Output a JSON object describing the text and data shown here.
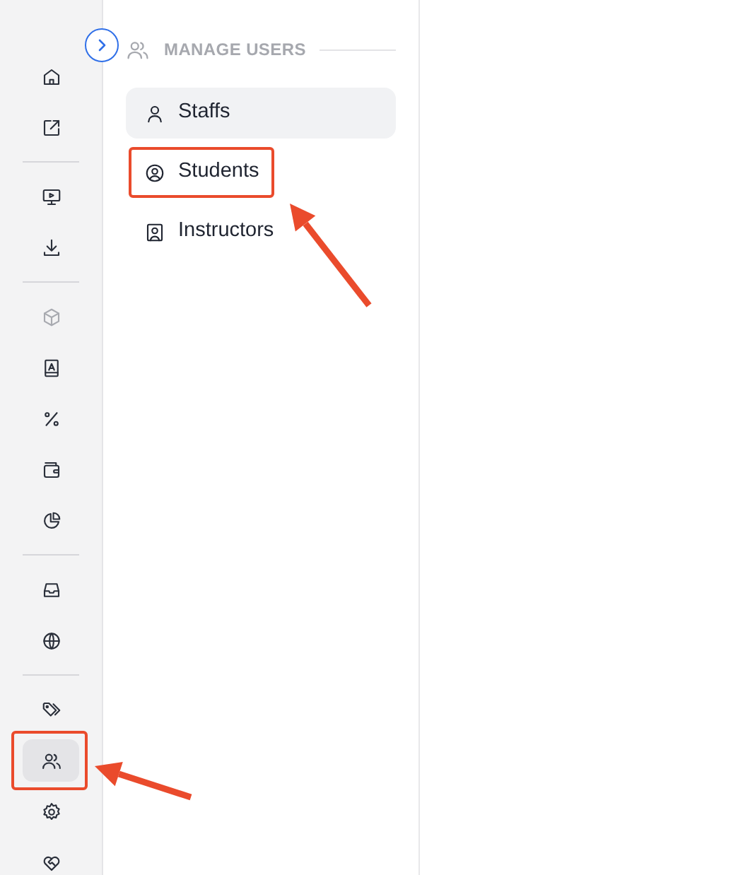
{
  "rail": {
    "groups": [
      [
        {
          "selected": false,
          "disabled": false,
          "highlighted": false
        },
        {
          "selected": false,
          "disabled": false,
          "highlighted": false
        }
      ],
      [
        {
          "selected": false,
          "disabled": false,
          "highlighted": false
        },
        {
          "selected": false,
          "disabled": false,
          "highlighted": false
        }
      ],
      [
        {
          "selected": false,
          "disabled": true,
          "highlighted": false
        },
        {
          "selected": false,
          "disabled": false,
          "highlighted": false
        },
        {
          "selected": false,
          "disabled": false,
          "highlighted": false
        },
        {
          "selected": false,
          "disabled": false,
          "highlighted": false
        },
        {
          "selected": false,
          "disabled": false,
          "highlighted": false
        }
      ],
      [
        {
          "selected": false,
          "disabled": false,
          "highlighted": false
        },
        {
          "selected": false,
          "disabled": false,
          "highlighted": false
        }
      ],
      [
        {
          "selected": false,
          "disabled": false,
          "highlighted": false
        },
        {
          "selected": true,
          "disabled": false,
          "highlighted": true
        },
        {
          "selected": false,
          "disabled": false,
          "highlighted": false
        },
        {
          "selected": false,
          "disabled": false,
          "highlighted": false
        }
      ]
    ]
  },
  "panel": {
    "title": "MANAGE USERS",
    "items": [
      {
        "label": "Staffs",
        "selected": true,
        "highlighted": false
      },
      {
        "label": "Students",
        "selected": false,
        "highlighted": true
      },
      {
        "label": "Instructors",
        "selected": false,
        "highlighted": false
      }
    ]
  }
}
